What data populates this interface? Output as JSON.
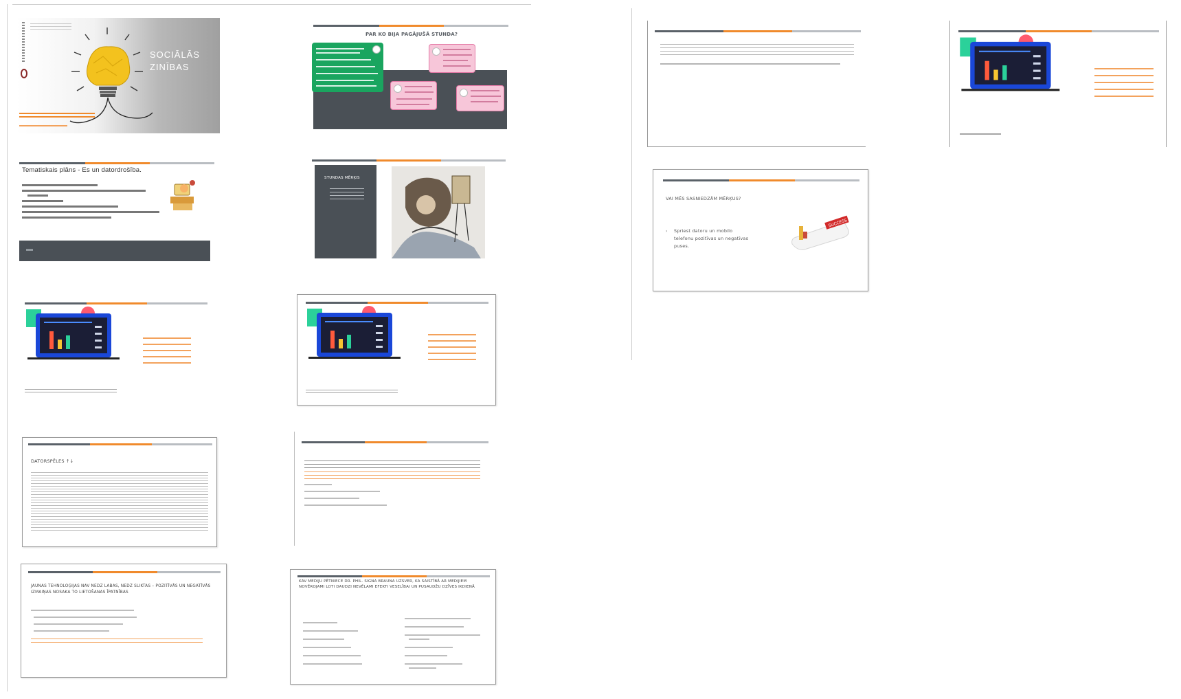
{
  "slides": {
    "title_slide": {
      "title_line1": "SOCIĀLĀS",
      "title_line2": "ZINĪBAS"
    },
    "plan_slide": {
      "heading": "PAR KO BIJA PAGĀJUŠĀ STUNDA?"
    },
    "topic_plan": {
      "title": "Tematiskais plāns - Es un datordrošība."
    },
    "lesson_goal": {
      "label": "STUNDAS MĒRĶIS"
    },
    "game_slide": {
      "heading": "DATORSPĒLES ↑↓"
    },
    "tech_slide": {
      "heading": "JAUNAS TEHNOLOĢIJAS NAV NEDZ LABAS, NEDZ SLIKTAS – POZITĪVĀS UN NEGATĪVĀS IZMAIŅAS NOSAKA TO LIETOŠANAS ĪPATNĪBAS"
    },
    "media_slide": {
      "heading": "KAV MEDIJU PĒTNIECE DR. PHIL. SIGNA BRAUNA UZSVER, KA SAISTĪBĀ AR MEDIJIEM NOVĒROJAMI LOTI DAUDZI NEVĒLAMI EFEKTI VESELĪBAI UN PUSAUDŽU DZĪVES IKDIENĀ"
    },
    "goal_check": {
      "heading": "VAI MĒS SASNIEDZĀM MĒRĶUS?",
      "bullet": "Spriest datoru un mobilo telefonu pozitīvas un negatīvas puses."
    }
  },
  "icons": {
    "laptop_chart": "laptop-chart-icon",
    "lightbulb": "crumpled-paper-lightbulb-icon",
    "success_badge": "success-key-icon",
    "cartoon_computer": "cartoon-computer-person-icon"
  },
  "colors": {
    "accent_orange": "#f08a2c",
    "dark_slate": "#4a5056",
    "green": "#1aa55f",
    "pink": "#f7c6d9"
  }
}
